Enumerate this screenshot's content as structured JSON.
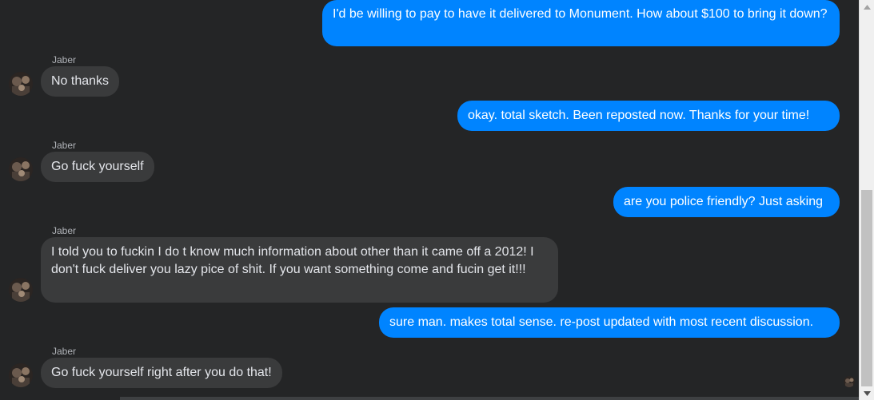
{
  "messages": [
    {
      "direction": "out",
      "text": "I'd be willing to pay to have it delivered to Monument.  How about $100 to bring it down?"
    },
    {
      "direction": "in",
      "sender": "Jaber",
      "text": "No thanks"
    },
    {
      "direction": "out",
      "text": "okay.  total sketch.  Been reposted now.  Thanks for your time!"
    },
    {
      "direction": "in",
      "sender": "Jaber",
      "text": "Go fuck yourself"
    },
    {
      "direction": "out",
      "text": "are you police friendly?  Just asking"
    },
    {
      "direction": "in",
      "sender": "Jaber",
      "text": "I told you to fuckin I do t know much information about other than it came off a 2012! I don't fuck deliver you lazy pice of shit. If you want something come and fucin get it!!!"
    },
    {
      "direction": "out",
      "text": "sure man.  makes total sense.  re-post updated with most recent discussion."
    },
    {
      "direction": "in",
      "sender": "Jaber",
      "text": "Go fuck yourself right after you do that!"
    }
  ],
  "colors": {
    "background": "#242526",
    "outgoing_bubble": "#0084ff",
    "incoming_bubble": "#3a3b3c",
    "incoming_text": "#e4e6eb",
    "sender_name": "#b0b3b8"
  },
  "icons": {
    "avatar": "contact-avatar-icon",
    "read_receipt": "read-receipt-avatar-icon",
    "scroll_up": "scroll-up-arrow-icon",
    "scroll_down": "scroll-down-arrow-icon"
  }
}
